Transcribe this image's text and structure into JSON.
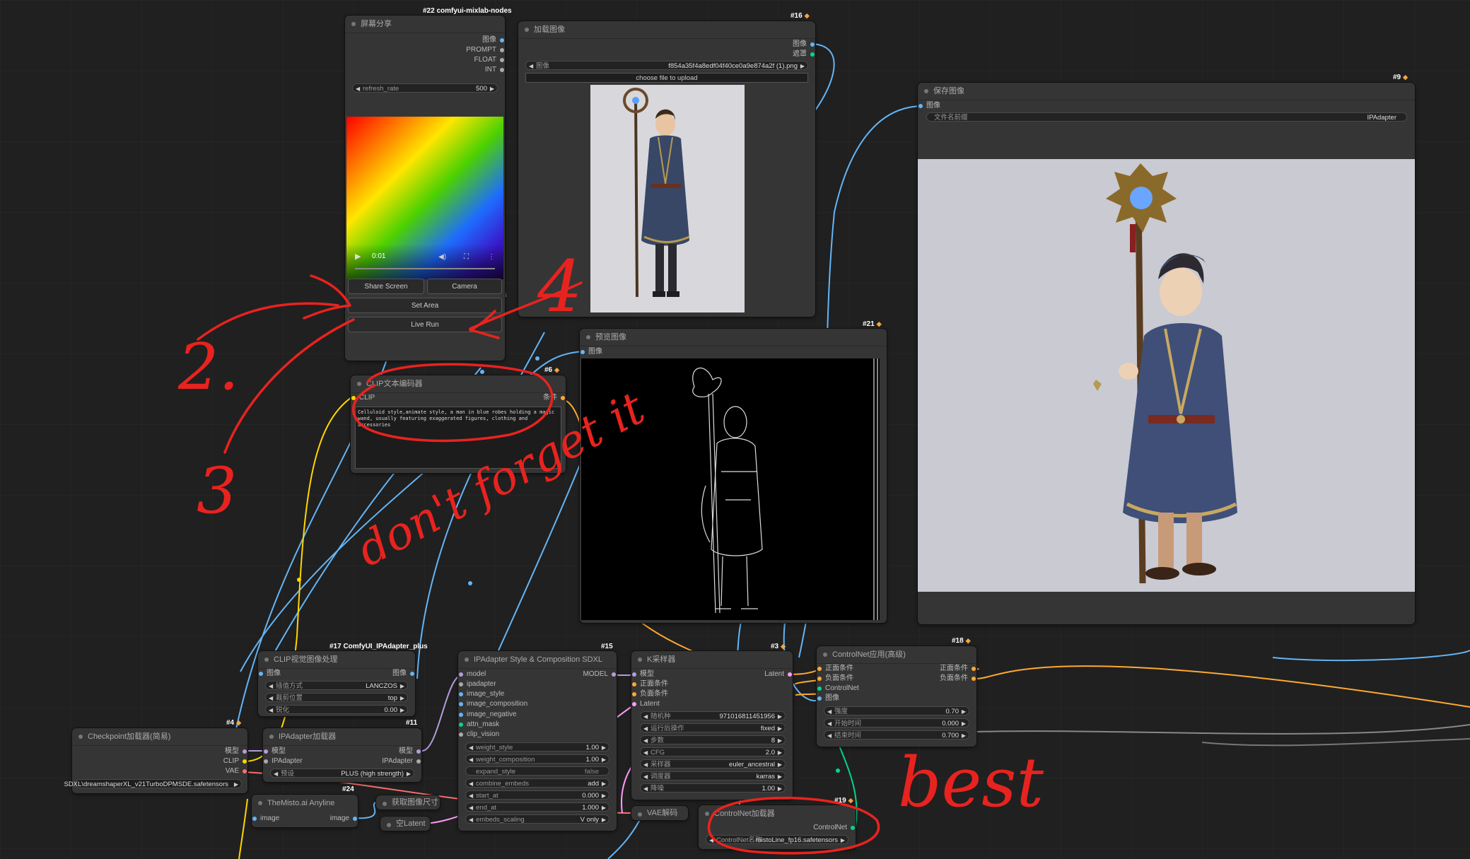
{
  "colors": {
    "image": "#64b5f6",
    "model": "#b39ddb",
    "clip": "#ffd500",
    "vae": "#ff6e6e",
    "conditioning": "#ffa931",
    "latent": "#ff9cf9",
    "controlnet": "#00d78d",
    "plain": "#aaaaaa",
    "annotation": "#e8231f"
  },
  "annotations": {
    "n2": "2.",
    "n3": "3",
    "n4": "4",
    "dont_forget": "don't forget it",
    "best": "best"
  },
  "nodes": {
    "screen_share": {
      "badge": "#22 comfyui-mixlab-nodes",
      "title": "屏幕分享",
      "outputs": [
        "图像",
        "PROMPT",
        "FLOAT",
        "INT"
      ],
      "refresh_label": "refresh_rate",
      "refresh_value": "500",
      "video_time": "0:01",
      "share_button": "Share Screen",
      "camera_button": "Camera",
      "set_area_button": "Set Area",
      "live_run_button": "Live Run"
    },
    "load_image": {
      "badge": "#16",
      "title": "加载图像",
      "outputs": [
        "图像",
        "遮罩"
      ],
      "image_label": "图像",
      "image_value": "f854a35f4a8edf04f40ce0a9e874a2f (1).png",
      "upload_button": "choose file to upload"
    },
    "save_image": {
      "badge": "#9",
      "title": "保存图像",
      "input": "图像",
      "prefix_label": "文件名前缀",
      "prefix_value": "IPAdapter"
    },
    "preview_image": {
      "badge": "#21",
      "title": "预览图像",
      "input": "图像"
    },
    "clip_text": {
      "badge": "#6",
      "title": "CLIP文本编码器",
      "input": "CLIP",
      "output": "条件",
      "prompt": "Celluloid style,animate style, a man in blue robes holding a magic wand, usually featuring exaggerated figures, clothing and accessories"
    },
    "clip_vision": {
      "badge": "#17 ComfyUI_IPAdapter_plus",
      "title": "CLIP视觉图像处理",
      "input": "图像",
      "output": "图像",
      "widgets": [
        {
          "label": "插值方式",
          "value": "LANCZOS"
        },
        {
          "label": "裁剪位置",
          "value": "top"
        },
        {
          "label": "锐化",
          "value": "0.00"
        }
      ]
    },
    "checkpoint": {
      "badge": "#4",
      "title": "Checkpoint加载器(简易)",
      "outputs": [
        "模型",
        "CLIP",
        "VAE"
      ],
      "ckpt_value": "SDXL\\dreamshaperXL_v21TurboDPMSDE.safetensors"
    },
    "ipadapter_loader": {
      "badge": "#11",
      "title": "IPAdapter加载器",
      "inputs": [
        "模型"
      ],
      "outputs": [
        "模型",
        "IPAdapter"
      ],
      "input2": "IPAdapter",
      "preset_label": "预设",
      "preset_value": "PLUS (high strength)"
    },
    "anyline": {
      "badge": "#24",
      "title": "TheMisto.ai Anyline",
      "input": "image",
      "output": "image"
    },
    "get_size": {
      "title": "获取图像尺寸"
    },
    "empty_latent": {
      "title": "空Latent"
    },
    "ipa_style": {
      "badge": "#15",
      "title": "IPAdapter Style & Composition SDXL",
      "inputs": [
        "model",
        "ipadapter",
        "image_style",
        "image_composition",
        "image_negative",
        "attn_mask",
        "clip_vision"
      ],
      "output": "MODEL",
      "widgets": [
        {
          "label": "weight_style",
          "value": "1.00"
        },
        {
          "label": "weight_composition",
          "value": "1.00"
        },
        {
          "label": "expand_style",
          "value": "false"
        },
        {
          "label": "combine_embeds",
          "value": "add"
        },
        {
          "label": "start_at",
          "value": "0.000"
        },
        {
          "label": "end_at",
          "value": "1.000"
        },
        {
          "label": "embeds_scaling",
          "value": "V only"
        }
      ]
    },
    "ksampler": {
      "badge": "#3",
      "title": "K采样器",
      "inputs": [
        "模型",
        "正面条件",
        "负面条件",
        "Latent"
      ],
      "output": "Latent",
      "widgets": [
        {
          "label": "随机种",
          "value": "971016811451956"
        },
        {
          "label": "运行后操作",
          "value": "fixed"
        },
        {
          "label": "步数",
          "value": "8"
        },
        {
          "label": "CFG",
          "value": "2.0"
        },
        {
          "label": "采样器",
          "value": "euler_ancestral"
        },
        {
          "label": "调度器",
          "value": "karras"
        },
        {
          "label": "降噪",
          "value": "1.00"
        }
      ]
    },
    "controlnet_apply": {
      "badge": "#18",
      "title": "ControlNet应用(高级)",
      "inputs": [
        "正面条件",
        "负面条件",
        "ControlNet",
        "图像"
      ],
      "outputs": [
        "正面条件",
        "负面条件"
      ],
      "widgets": [
        {
          "label": "强度",
          "value": "0.70"
        },
        {
          "label": "开始时间",
          "value": "0.000"
        },
        {
          "label": "结束时间",
          "value": "0.700"
        }
      ]
    },
    "vae_decode": {
      "title": "VAE解码"
    },
    "controlnet_loader": {
      "badge": "#19",
      "title": "ControlNet加载器",
      "output": "ControlNet",
      "name_label": "ControlNet名称",
      "name_value": "mistoLine_fp16.safetensors"
    }
  }
}
